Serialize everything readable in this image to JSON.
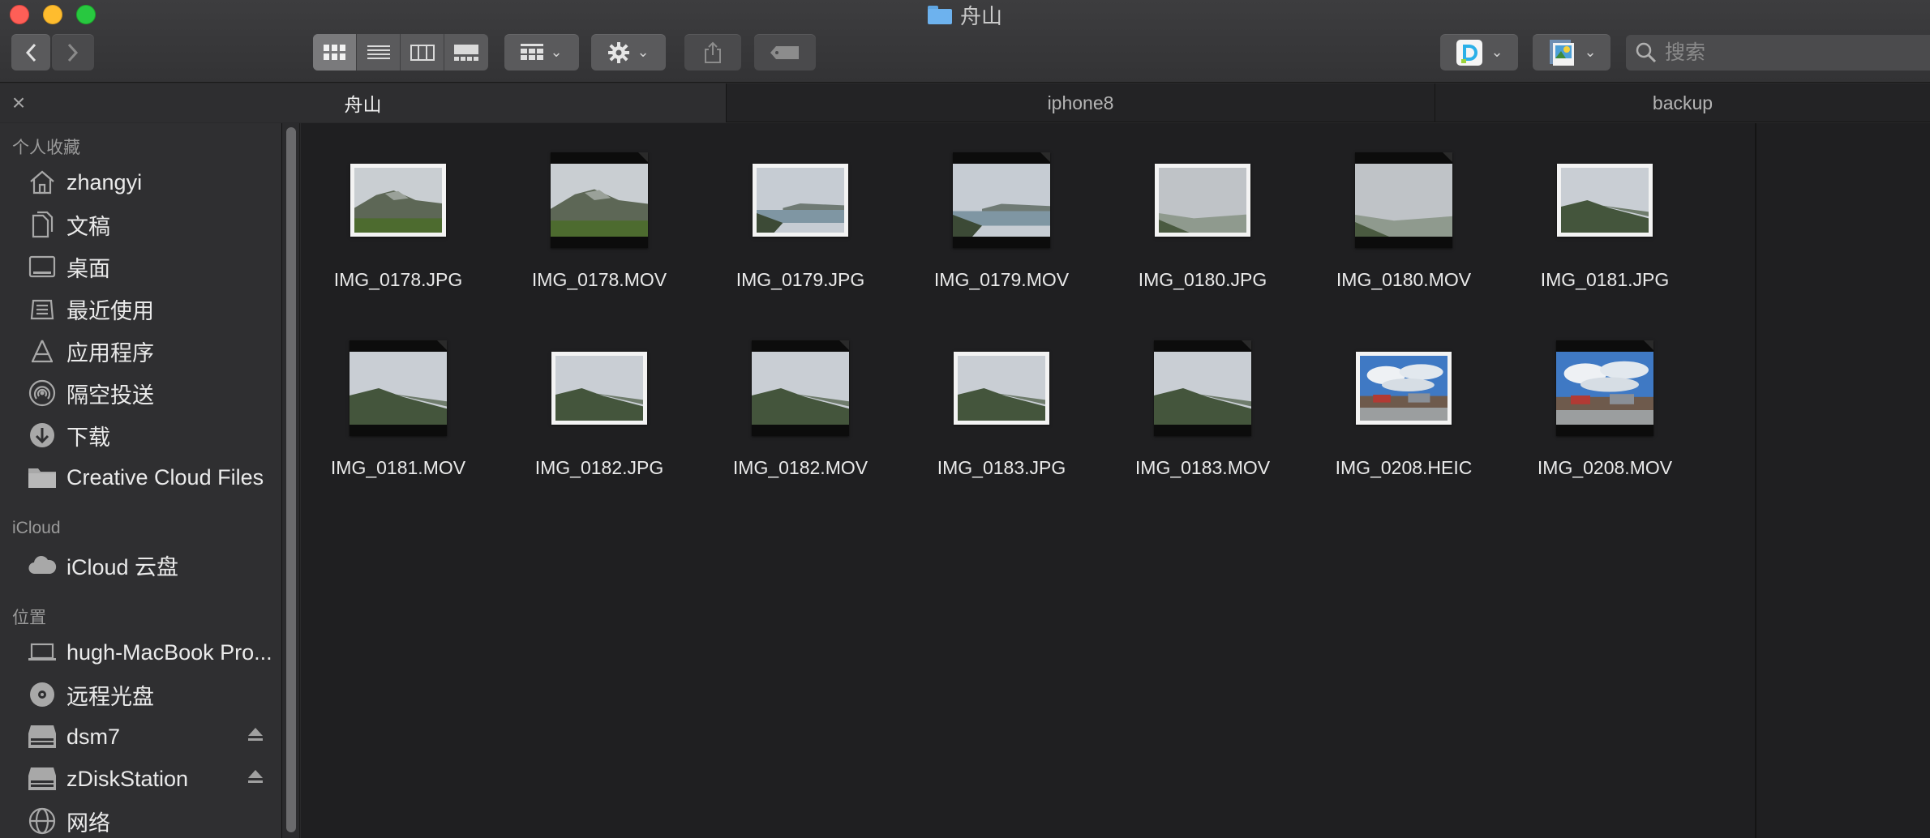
{
  "window": {
    "title": "舟山",
    "title_icon": "folder-icon"
  },
  "toolbar": {
    "back_icon": "chevron-left-icon",
    "forward_icon": "chevron-right-icon",
    "view_modes": [
      "icon-view",
      "list-view",
      "column-view",
      "gallery-view"
    ],
    "active_view": "icon-view",
    "group_icon": "group-by-icon",
    "action_icon": "gear-icon",
    "share_icon": "share-icon",
    "tag_icon": "tag-icon",
    "extension1_icon": "app-extension-icon",
    "extension2_icon": "preview-extension-icon",
    "search_placeholder": "搜索"
  },
  "tabs": [
    {
      "label": "舟山",
      "active": true
    },
    {
      "label": "iphone8",
      "active": false
    },
    {
      "label": "backup",
      "active": false
    }
  ],
  "sidebar": {
    "favorites_title": "个人收藏",
    "favorites": [
      {
        "label": "zhangyi",
        "icon": "home-icon"
      },
      {
        "label": "文稿",
        "icon": "documents-icon"
      },
      {
        "label": "桌面",
        "icon": "desktop-icon"
      },
      {
        "label": "最近使用",
        "icon": "recents-icon"
      },
      {
        "label": "应用程序",
        "icon": "applications-icon"
      },
      {
        "label": "隔空投送",
        "icon": "airdrop-icon"
      },
      {
        "label": "下载",
        "icon": "downloads-icon"
      },
      {
        "label": "Creative Cloud Files",
        "icon": "folder-icon"
      }
    ],
    "icloud_title": "iCloud",
    "icloud": [
      {
        "label": "iCloud 云盘",
        "icon": "cloud-icon"
      }
    ],
    "locations_title": "位置",
    "locations": [
      {
        "label": "hugh-MacBook Pro...",
        "icon": "laptop-icon",
        "eject": false
      },
      {
        "label": "远程光盘",
        "icon": "disc-icon",
        "eject": false
      },
      {
        "label": "dsm7",
        "icon": "server-icon",
        "eject": true
      },
      {
        "label": "zDiskStation",
        "icon": "server-icon",
        "eject": true
      },
      {
        "label": "网络",
        "icon": "network-icon",
        "eject": false
      }
    ]
  },
  "files": [
    {
      "name": "IMG_0178.JPG",
      "kind": "photo",
      "scene": "mountain"
    },
    {
      "name": "IMG_0178.MOV",
      "kind": "video",
      "scene": "mountain"
    },
    {
      "name": "IMG_0179.JPG",
      "kind": "photo",
      "scene": "sea"
    },
    {
      "name": "IMG_0179.MOV",
      "kind": "video",
      "scene": "sea"
    },
    {
      "name": "IMG_0180.JPG",
      "kind": "photo",
      "scene": "haze"
    },
    {
      "name": "IMG_0180.MOV",
      "kind": "video",
      "scene": "haze"
    },
    {
      "name": "IMG_0181.JPG",
      "kind": "photo",
      "scene": "slope"
    },
    {
      "name": "IMG_0181.MOV",
      "kind": "video",
      "scene": "slope"
    },
    {
      "name": "IMG_0182.JPG",
      "kind": "photo",
      "scene": "slope"
    },
    {
      "name": "IMG_0182.MOV",
      "kind": "video",
      "scene": "slope"
    },
    {
      "name": "IMG_0183.JPG",
      "kind": "photo",
      "scene": "slope"
    },
    {
      "name": "IMG_0183.MOV",
      "kind": "video",
      "scene": "slope"
    },
    {
      "name": "IMG_0208.HEIC",
      "kind": "photo",
      "scene": "town"
    },
    {
      "name": "IMG_0208.MOV",
      "kind": "video",
      "scene": "town"
    }
  ],
  "colors": {
    "window_bg": "#1f1f21",
    "sidebar_bg": "#2f2f31",
    "toolbar_bg": "#383839",
    "accent_folder": "#6db2ee"
  }
}
